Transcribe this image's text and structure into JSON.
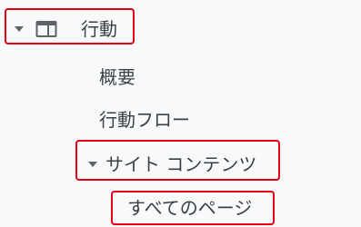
{
  "nav": {
    "behavior": {
      "label": "行動",
      "icon": "window-layout-icon",
      "expanded": true
    },
    "overview": {
      "label": "概要"
    },
    "behavior_flow": {
      "label": "行動フロー"
    },
    "site_content": {
      "label": "サイト コンテンツ",
      "expanded": true
    },
    "all_pages": {
      "label": "すべてのページ"
    }
  },
  "colors": {
    "highlight": "#e60012",
    "text": "#3c4043",
    "icon": "#5f6368",
    "background": "#f8f9fa"
  }
}
